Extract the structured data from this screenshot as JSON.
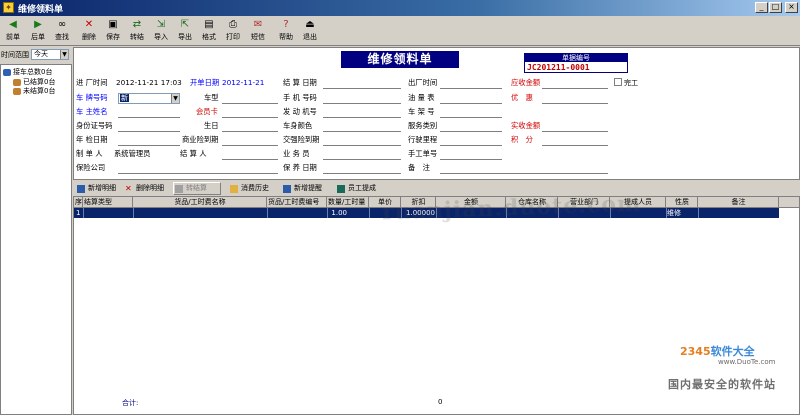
{
  "window": {
    "title": "维修领料单",
    "controls": [
      "minimize",
      "maximize",
      "close"
    ]
  },
  "toolbar": {
    "buttons": [
      {
        "label": "前单",
        "icon": "prev-arrow-icon"
      },
      {
        "label": "后单",
        "icon": "next-arrow-icon"
      },
      {
        "label": "查找",
        "icon": "binoculars-icon"
      },
      {
        "label": "删除",
        "icon": "delete-x-icon"
      },
      {
        "label": "保存",
        "icon": "floppy-icon"
      },
      {
        "label": "转结",
        "icon": "transfer-icon"
      },
      {
        "label": "导入",
        "icon": "import-icon"
      },
      {
        "label": "导出",
        "icon": "export-icon"
      },
      {
        "label": "格式",
        "icon": "format-icon"
      },
      {
        "label": "打印",
        "icon": "printer-icon"
      },
      {
        "label": "短信",
        "icon": "sms-icon"
      },
      {
        "label": "帮助",
        "icon": "help-icon"
      },
      {
        "label": "退出",
        "icon": "exit-icon"
      }
    ]
  },
  "left_panel": {
    "range_label": "时间范围",
    "range_value": "今天",
    "tree": {
      "root": "接车总数0台",
      "children": [
        "已结算0台",
        "未结算0台"
      ]
    }
  },
  "form": {
    "title": "维修领料单",
    "doc_no_label": "单据编号",
    "doc_no": "JC201211-0001",
    "done_label": "完工",
    "fields": {
      "entry_time_label": "进 厂时间",
      "entry_time": "2012-11-21 17:03",
      "open_date_label": "开单日期",
      "open_date": "2012-11-21",
      "settle_date_label": "结 算 日期",
      "exit_time_label": "出厂时间",
      "receivable_label": "应收金额",
      "plate_label": "车 牌号码",
      "plate_value": "新",
      "car_type_label": "车型",
      "phone_label": "手 机 号码",
      "fuel_label": "油 量 表",
      "discount_label": "优　惠",
      "owner_label": "车 主姓名",
      "member_card_label": "会员卡",
      "engine_label": "发 动 机号",
      "vin_label": "车 架 号",
      "id_label": "身份证号码",
      "birthday_label": "生日",
      "color_label": "车身颜色",
      "service_type_label": "服务类别",
      "received_label": "实收金额",
      "inspection_label": "年 检日期",
      "commercial_ins_label": "商业险到期",
      "compulsory_ins_label": "交强险到期",
      "mileage_label": "行驶里程",
      "points_label": "积　分",
      "creator_label": "制 单 人",
      "creator": "系统管理员",
      "settler_label": "结 算 人",
      "salesman_label": "业 务 员",
      "manual_no_label": "手工单号",
      "insurer_label": "保险公司",
      "maint_date_label": "保 养 日期",
      "remark_label": "备　注"
    }
  },
  "detail_toolbar": {
    "add": "新增明细",
    "delete": "删除明细",
    "settle": "转结算",
    "history": "消费历史",
    "remind": "新增提醒",
    "commission": "员工提成"
  },
  "grid": {
    "columns": [
      "序",
      "结算类型",
      "货品/工时费名称",
      "货品/工时费编号",
      "数量/工时量",
      "单价",
      "折扣",
      "金额",
      "仓库名称",
      "营业部门",
      "提成人员",
      "性质",
      "备注"
    ],
    "rows": [
      {
        "seq": "1",
        "qty": "1.00",
        "discount": "1.00000",
        "nature": "维修"
      }
    ],
    "total_label": "合计:",
    "total_value": "0"
  },
  "watermarks": {
    "center": "ruanjian.duote.com",
    "brand_a": "2345",
    "brand_b": "软件大全",
    "site": "www.DuoTe.com",
    "slogan": "国内最安全的软件站"
  },
  "colors": {
    "titlebar": "#0a246a",
    "form_title_bg": "#000080",
    "blue_label": "#0000ff",
    "red_label": "#d00000",
    "selection": "#0a246a"
  }
}
